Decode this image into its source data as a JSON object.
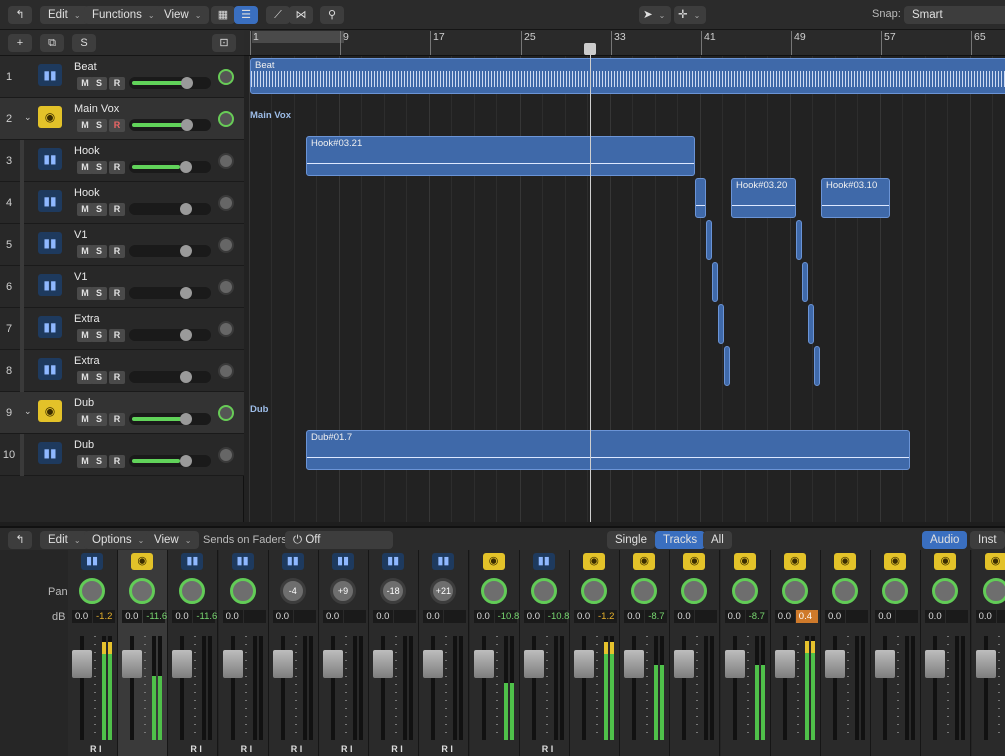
{
  "toolbar": {
    "edit": "Edit",
    "functions": "Functions",
    "view": "View",
    "snap_label": "Snap:",
    "snap_value": "Smart"
  },
  "track_header": {
    "add": "+",
    "dup": "⧉",
    "solo": "S"
  },
  "ruler": [
    "1",
    "9",
    "17",
    "25",
    "33",
    "41",
    "49",
    "57",
    "65"
  ],
  "tracks": [
    {
      "num": "1",
      "name": "Beat",
      "m": "M",
      "s": "S",
      "r": "R"
    },
    {
      "num": "2",
      "name": "Main Vox",
      "m": "M",
      "s": "S",
      "r": "R"
    },
    {
      "num": "3",
      "name": "Hook",
      "m": "M",
      "s": "S",
      "r": "R"
    },
    {
      "num": "4",
      "name": "Hook",
      "m": "M",
      "s": "S",
      "r": "R"
    },
    {
      "num": "5",
      "name": "V1",
      "m": "M",
      "s": "S",
      "r": "R"
    },
    {
      "num": "6",
      "name": "V1",
      "m": "M",
      "s": "S",
      "r": "R"
    },
    {
      "num": "7",
      "name": "Extra",
      "m": "M",
      "s": "S",
      "r": "R"
    },
    {
      "num": "8",
      "name": "Extra",
      "m": "M",
      "s": "S",
      "r": "R"
    },
    {
      "num": "9",
      "name": "Dub",
      "m": "M",
      "s": "S",
      "r": "R"
    },
    {
      "num": "10",
      "name": "Dub",
      "m": "M",
      "s": "S",
      "r": "R"
    }
  ],
  "regions": {
    "beat": "Beat",
    "main_vox": "Main Vox",
    "hook_1": "Hook#03.21",
    "hook_2": "Hook#03.20",
    "hook_3": "Hook#03.10",
    "dub_folder": "Dub",
    "dub_region": "Dub#01.7"
  },
  "mixer_bar": {
    "edit": "Edit",
    "options": "Options",
    "view": "View",
    "sends_label": "Sends on Faders:",
    "sends_value": "Off",
    "single": "Single",
    "tracks": "Tracks",
    "all": "All",
    "audio": "Audio",
    "inst": "Inst"
  },
  "mixer_labels": {
    "pan": "Pan",
    "db": "dB"
  },
  "strips": [
    {
      "pan": "",
      "db_a": "0.0",
      "db_b": "-1.2",
      "tone": "y",
      "icon": "wave",
      "ri": "R I",
      "level": 0.94
    },
    {
      "pan": "",
      "db_a": "0.0",
      "db_b": "-11.6",
      "tone": "g",
      "icon": "folder",
      "ri": "",
      "level": 0.62
    },
    {
      "pan": "",
      "db_a": "0.0",
      "db_b": "-11.6",
      "tone": "g",
      "icon": "wave",
      "ri": "R I",
      "level": 0
    },
    {
      "pan": "",
      "db_a": "0.0",
      "db_b": "",
      "tone": "g",
      "icon": "wave",
      "ri": "R I",
      "level": 0
    },
    {
      "pan": "-4",
      "db_a": "0.0",
      "db_b": "",
      "tone": "g",
      "icon": "wave",
      "ri": "R I",
      "level": 0
    },
    {
      "pan": "+9",
      "db_a": "0.0",
      "db_b": "",
      "tone": "g",
      "icon": "wave",
      "ri": "R I",
      "level": 0
    },
    {
      "pan": "-18",
      "db_a": "0.0",
      "db_b": "",
      "tone": "g",
      "icon": "wave",
      "ri": "R I",
      "level": 0
    },
    {
      "pan": "+21",
      "db_a": "0.0",
      "db_b": "",
      "tone": "g",
      "icon": "wave",
      "ri": "R I",
      "level": 0
    },
    {
      "pan": "",
      "db_a": "0.0",
      "db_b": "-10.8",
      "tone": "g",
      "icon": "folder",
      "ri": "",
      "level": 0.55
    },
    {
      "pan": "",
      "db_a": "0.0",
      "db_b": "-10.8",
      "tone": "g",
      "icon": "wave",
      "ri": "R I",
      "level": 0
    },
    {
      "pan": "",
      "db_a": "0.0",
      "db_b": "-1.2",
      "tone": "y",
      "icon": "folder",
      "ri": "",
      "level": 0.94
    },
    {
      "pan": "",
      "db_a": "0.0",
      "db_b": "-8.7",
      "tone": "g",
      "icon": "folder",
      "ri": "",
      "level": 0.72
    },
    {
      "pan": "",
      "db_a": "0.0",
      "db_b": "",
      "tone": "g",
      "icon": "folder",
      "ri": "",
      "level": 0
    },
    {
      "pan": "",
      "db_a": "0.0",
      "db_b": "-8.7",
      "tone": "g",
      "icon": "folder",
      "ri": "",
      "level": 0.72
    },
    {
      "pan": "",
      "db_a": "0.0",
      "db_b": "0.4",
      "tone": "o",
      "icon": "folder",
      "ri": "",
      "level": 0.95
    },
    {
      "pan": "",
      "db_a": "0.0",
      "db_b": "",
      "tone": "g",
      "icon": "folder",
      "ri": "",
      "level": 0
    },
    {
      "pan": "",
      "db_a": "0.0",
      "db_b": "",
      "tone": "g",
      "icon": "folder",
      "ri": "",
      "level": 0
    },
    {
      "pan": "",
      "db_a": "0.0",
      "db_b": "",
      "tone": "g",
      "icon": "folder",
      "ri": "",
      "level": 0
    },
    {
      "pan": "",
      "db_a": "0.0",
      "db_b": "",
      "tone": "g",
      "icon": "folder",
      "ri": "",
      "level": 0
    }
  ]
}
